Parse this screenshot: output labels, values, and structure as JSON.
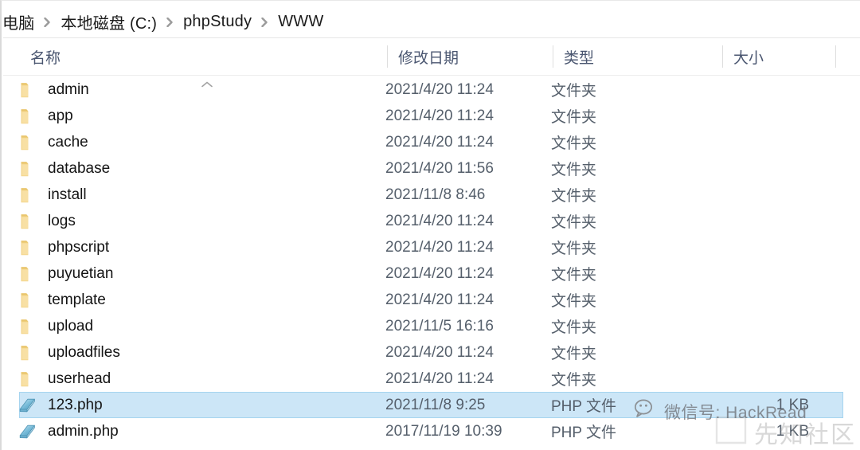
{
  "breadcrumb": {
    "name": "path-breadcrumb",
    "items": [
      {
        "label": "电脑"
      },
      {
        "label": "本地磁盘 (C:)"
      },
      {
        "label": "phpStudy"
      },
      {
        "label": "WWW"
      }
    ]
  },
  "columns": {
    "name": "名称",
    "date": "修改日期",
    "type": "类型",
    "size": "大小",
    "sort_indicator": "ascending"
  },
  "rows": [
    {
      "name": "admin",
      "date": "2021/4/20 11:24",
      "type": "文件夹",
      "size": "",
      "icon": "folder-icon",
      "selected": false
    },
    {
      "name": "app",
      "date": "2021/4/20 11:24",
      "type": "文件夹",
      "size": "",
      "icon": "folder-icon",
      "selected": false
    },
    {
      "name": "cache",
      "date": "2021/4/20 11:24",
      "type": "文件夹",
      "size": "",
      "icon": "folder-icon",
      "selected": false
    },
    {
      "name": "database",
      "date": "2021/4/20 11:56",
      "type": "文件夹",
      "size": "",
      "icon": "folder-icon",
      "selected": false
    },
    {
      "name": "install",
      "date": "2021/11/8 8:46",
      "type": "文件夹",
      "size": "",
      "icon": "folder-icon",
      "selected": false
    },
    {
      "name": "logs",
      "date": "2021/4/20 11:24",
      "type": "文件夹",
      "size": "",
      "icon": "folder-icon",
      "selected": false
    },
    {
      "name": "phpscript",
      "date": "2021/4/20 11:24",
      "type": "文件夹",
      "size": "",
      "icon": "folder-icon",
      "selected": false
    },
    {
      "name": "puyuetian",
      "date": "2021/4/20 11:24",
      "type": "文件夹",
      "size": "",
      "icon": "folder-icon",
      "selected": false
    },
    {
      "name": "template",
      "date": "2021/4/20 11:24",
      "type": "文件夹",
      "size": "",
      "icon": "folder-icon",
      "selected": false
    },
    {
      "name": "upload",
      "date": "2021/11/5 16:16",
      "type": "文件夹",
      "size": "",
      "icon": "folder-icon",
      "selected": false
    },
    {
      "name": "uploadfiles",
      "date": "2021/4/20 11:24",
      "type": "文件夹",
      "size": "",
      "icon": "folder-icon",
      "selected": false
    },
    {
      "name": "userhead",
      "date": "2021/4/20 11:24",
      "type": "文件夹",
      "size": "",
      "icon": "folder-icon",
      "selected": false
    },
    {
      "name": "123.php",
      "date": "2021/11/8 9:25",
      "type": "PHP 文件",
      "size": "1 KB",
      "icon": "php-file-icon",
      "selected": true
    },
    {
      "name": "admin.php",
      "date": "2017/11/19 10:39",
      "type": "PHP 文件",
      "size": "1 KB",
      "icon": "php-file-icon",
      "selected": false
    }
  ],
  "watermark": {
    "wechat_label": "微信号: HackRead",
    "wechat_icon": "wechat-icon",
    "brand_label": "先知社区",
    "brand_icon": "zhihu-z-logo-icon"
  },
  "colors": {
    "selection_fill": "#cce6f7",
    "selection_border": "#a6d4ef",
    "folder_yellow": "#f6d98c",
    "php_blue": "#7fc4e0",
    "header_text": "#4a5670"
  }
}
